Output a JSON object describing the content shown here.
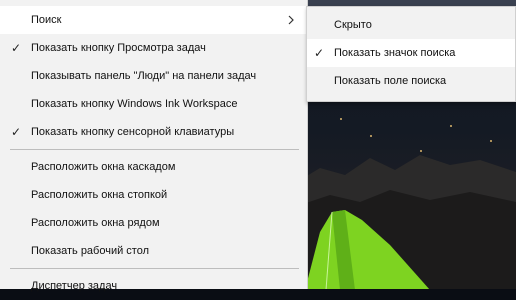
{
  "menu": {
    "items": [
      {
        "label": "Поиск",
        "checked": false,
        "has_submenu": true,
        "highlighted": true
      },
      {
        "label": "Показать кнопку Просмотра задач",
        "checked": true
      },
      {
        "label": "Показывать панель \"Люди\" на панели задач",
        "checked": false
      },
      {
        "label": "Показать кнопку Windows Ink Workspace",
        "checked": false
      },
      {
        "label": "Показать кнопку сенсорной клавиатуры",
        "checked": true
      },
      {
        "label": "Расположить окна каскадом",
        "checked": false
      },
      {
        "label": "Расположить окна стопкой",
        "checked": false
      },
      {
        "label": "Расположить окна рядом",
        "checked": false
      },
      {
        "label": "Показать рабочий стол",
        "checked": false
      },
      {
        "label": "Диспетчер задач",
        "checked": false
      }
    ]
  },
  "submenu": {
    "items": [
      {
        "label": "Скрыто",
        "checked": false
      },
      {
        "label": "Показать значок поиска",
        "checked": true,
        "highlighted": true
      },
      {
        "label": "Показать поле поиска",
        "checked": false
      }
    ]
  },
  "icons": {
    "check": "✓",
    "submenu_arrow": "chevron-right-icon"
  },
  "colors": {
    "menu_bg": "#f2f2f2",
    "highlight_bg": "#ffffff",
    "tent": "#7ed321"
  }
}
